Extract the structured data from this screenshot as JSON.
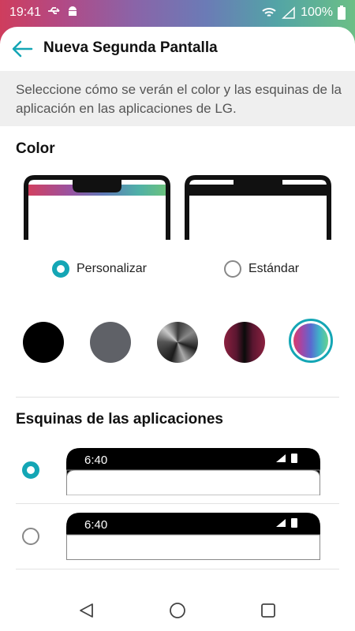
{
  "status_bar": {
    "time": "19:41",
    "battery_percent": "100%",
    "icons": [
      "usb-icon",
      "android-icon",
      "wifi-icon",
      "signal-icon",
      "battery-icon"
    ]
  },
  "header": {
    "title": "Nueva Segunda Pantalla",
    "back_icon": "arrow-left-icon"
  },
  "description": "Seleccione cómo se verán el color y las esquinas de la aplicación en las aplicaciones de LG.",
  "color_section": {
    "title": "Color",
    "options": [
      {
        "label": "Personalizar",
        "selected": true
      },
      {
        "label": "Estándar",
        "selected": false
      }
    ],
    "swatches": [
      {
        "name": "black",
        "selected": false
      },
      {
        "name": "gray",
        "selected": false
      },
      {
        "name": "metal-gradient",
        "selected": false
      },
      {
        "name": "purple-black",
        "selected": false
      },
      {
        "name": "rainbow",
        "selected": true
      }
    ]
  },
  "corners_section": {
    "title": "Esquinas de las aplicaciones",
    "options": [
      {
        "preview_time": "6:40",
        "style": "rounded",
        "selected": true
      },
      {
        "preview_time": "6:40",
        "style": "square",
        "selected": false
      }
    ]
  },
  "nav_bar": {
    "buttons": [
      "back-triangle-icon",
      "home-circle-icon",
      "recents-square-icon"
    ]
  },
  "colors": {
    "accent": "#14a6b5",
    "band_background": "#efefef"
  }
}
